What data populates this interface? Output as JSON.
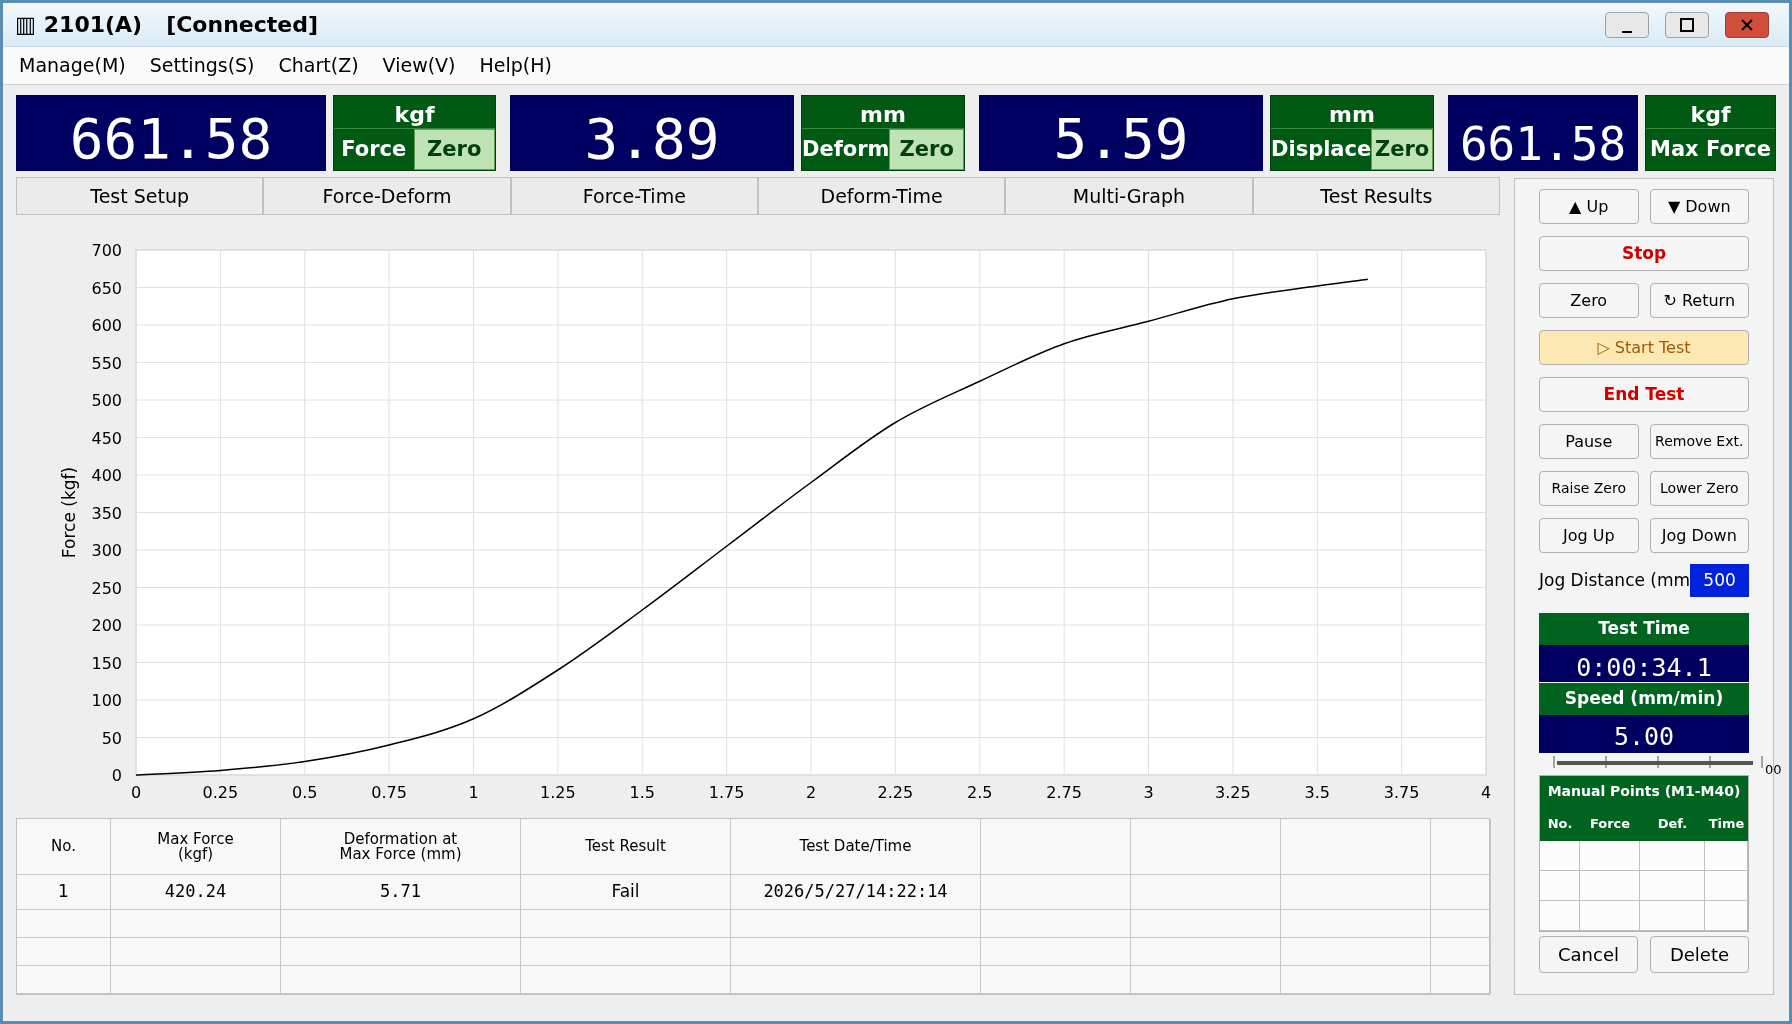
{
  "window": {
    "icon": "▥",
    "title": "2101(A)",
    "status": "[Connected]"
  },
  "menu": [
    "Manage(M)",
    "Settings(S)",
    "Chart(Z)",
    "View(V)",
    "Help(H)"
  ],
  "readouts": [
    {
      "value": "661.58",
      "unit": "kgf",
      "labels": [
        {
          "text": "Force",
          "kind": "label"
        },
        {
          "text": "Zero",
          "kind": "zero"
        }
      ]
    },
    {
      "value": "3.89",
      "unit": "mm",
      "labels": [
        {
          "text": "Deform",
          "kind": "label"
        },
        {
          "text": "Zero",
          "kind": "zero"
        }
      ]
    },
    {
      "value": "5.59",
      "unit": "mm",
      "labels": [
        {
          "text": "Displace",
          "kind": "label"
        },
        {
          "text": "Zero",
          "kind": "zero"
        }
      ]
    },
    {
      "value": "661.58",
      "unit": "kgf",
      "labels": [
        {
          "text": "Max Force",
          "kind": "label"
        }
      ]
    }
  ],
  "tabs": [
    {
      "label": "Test Setup",
      "selected": false
    },
    {
      "label": "Force-Deform",
      "selected": false
    },
    {
      "label": "Force-Time",
      "selected": false
    },
    {
      "label": "Deform-Time",
      "selected": false
    },
    {
      "label": "Multi-Graph",
      "selected": false
    },
    {
      "label": "Test Results",
      "selected": false
    }
  ],
  "chart": {
    "chart_data": {
      "type": "line",
      "grid": true,
      "ylabel": "Force (kgf)",
      "xlim": [
        0,
        4
      ],
      "ylim": [
        0,
        700
      ],
      "xticks": [
        {
          "value": 0,
          "label": "0"
        },
        {
          "value": 0.25,
          "label": "0.25"
        },
        {
          "value": 0.5,
          "label": "0.5"
        },
        {
          "value": 0.75,
          "label": "0.75"
        },
        {
          "value": 1,
          "label": "1"
        },
        {
          "value": 1.25,
          "label": "1.25"
        },
        {
          "value": 1.5,
          "label": "1.5"
        },
        {
          "value": 1.75,
          "label": "1.75"
        },
        {
          "value": 2,
          "label": "2"
        },
        {
          "value": 2.25,
          "label": "2.25"
        },
        {
          "value": 2.5,
          "label": "2.5"
        },
        {
          "value": 2.75,
          "label": "2.75"
        },
        {
          "value": 3,
          "label": "3"
        },
        {
          "value": 3.25,
          "label": "3.25"
        },
        {
          "value": 3.5,
          "label": "3.5"
        },
        {
          "value": 3.75,
          "label": "3.75"
        },
        {
          "value": 4,
          "label": "4"
        }
      ],
      "yticks": [
        {
          "value": 0,
          "label": "0"
        },
        {
          "value": 50,
          "label": "50"
        },
        {
          "value": 100,
          "label": "100"
        },
        {
          "value": 150,
          "label": "150"
        },
        {
          "value": 200,
          "label": "200"
        },
        {
          "value": 250,
          "label": "250"
        },
        {
          "value": 300,
          "label": "300"
        },
        {
          "value": 350,
          "label": "350"
        },
        {
          "value": 400,
          "label": "400"
        },
        {
          "value": 450,
          "label": "450"
        },
        {
          "value": 500,
          "label": "500"
        },
        {
          "value": 550,
          "label": "550"
        },
        {
          "value": 600,
          "label": "600"
        },
        {
          "value": 650,
          "label": "650"
        },
        {
          "value": 700,
          "label": "700"
        }
      ],
      "x": [
        0,
        0.25,
        0.5,
        0.75,
        1,
        1.25,
        1.5,
        1.75,
        2,
        2.25,
        2.5,
        2.75,
        3,
        3.25,
        3.5,
        3.65
      ],
      "series": [
        {
          "color": "#000000",
          "values": [
            0,
            6,
            18,
            40,
            75,
            140,
            220,
            305,
            390,
            470,
            525,
            575,
            605,
            635,
            652,
            661
          ]
        }
      ]
    }
  },
  "results": {
    "columns": [
      "No.",
      "Max Force\n(kgf)",
      "Deformation at\nMax Force (mm)",
      "Test Result",
      "Test Date/Time"
    ],
    "rows": [
      [
        "1",
        "420.24",
        "5.71",
        "Fail",
        "2026/5/27/14:22:14"
      ]
    ]
  },
  "controls": [
    {
      "label": "▲ Up",
      "kind": "normal",
      "wide": false
    },
    {
      "label": "▼ Down",
      "kind": "normal",
      "wide": false
    },
    {
      "label": "Stop",
      "kind": "danger",
      "wide": true
    },
    {
      "label": "Zero",
      "kind": "normal",
      "wide": false
    },
    {
      "label": "↻ Return",
      "kind": "normal",
      "wide": false
    },
    {
      "label": "▷ Start Test",
      "kind": "primary",
      "wide": true
    },
    {
      "label": "End Test",
      "kind": "danger",
      "wide": true
    },
    {
      "label": "Pause",
      "kind": "normal",
      "wide": false
    },
    {
      "label": "Remove Ext.",
      "kind": "small",
      "wide": false
    },
    {
      "label": "Raise Zero",
      "kind": "small",
      "wide": false
    },
    {
      "label": "Lower Zero",
      "kind": "small",
      "wide": false
    },
    {
      "label": "Jog Up",
      "kind": "normal",
      "wide": false
    },
    {
      "label": "Jog Down",
      "kind": "normal",
      "wide": false
    }
  ],
  "jog_distance": {
    "label": "Jog Distance (mm",
    "value": "500"
  },
  "test_time": {
    "label": "Test Time",
    "value": "0:00:34.1"
  },
  "speed": {
    "label": "Speed (mm/min)",
    "value": "5.00",
    "level": 1,
    "scale_end": "00"
  },
  "manual_points": {
    "title": "Manual Points (M1-M40)",
    "columns": [
      "No.",
      "Force",
      "Def.",
      "Time"
    ]
  },
  "footer_buttons": [
    "Cancel",
    "Delete"
  ]
}
